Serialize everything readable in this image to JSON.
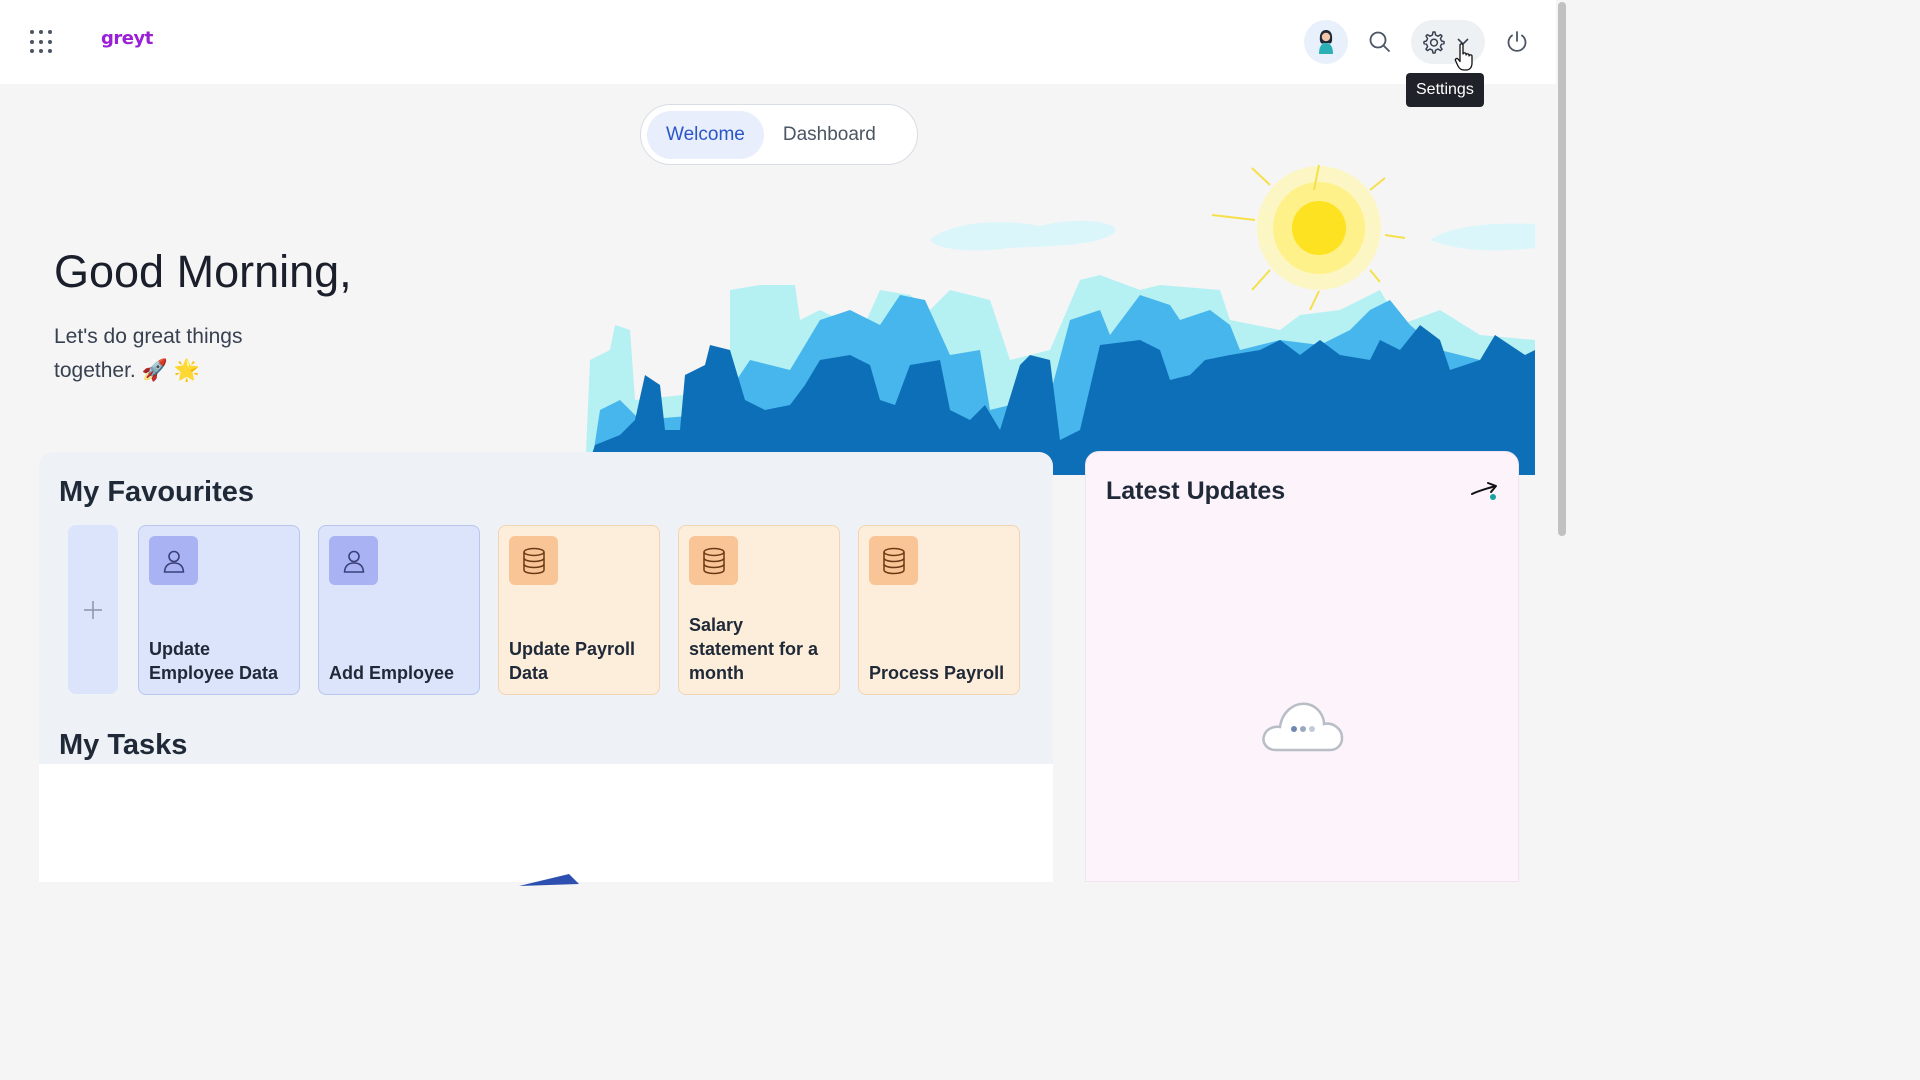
{
  "header": {
    "logo_text": "greyt",
    "settings_tooltip": "Settings"
  },
  "tabs": [
    {
      "label": "Welcome",
      "active": true
    },
    {
      "label": "Dashboard",
      "active": false
    }
  ],
  "greeting": {
    "title": "Good Morning,",
    "subtitle": "Let's do great things together. 🚀 🌟"
  },
  "favourites": {
    "title": "My Favourites",
    "items": [
      {
        "label": "Update Employee Data",
        "icon": "person-icon",
        "color": "blue"
      },
      {
        "label": "Add Employee",
        "icon": "person-icon",
        "color": "blue"
      },
      {
        "label": "Update Payroll Data",
        "icon": "database-icon",
        "color": "orange"
      },
      {
        "label": "Salary statement for a month",
        "icon": "database-icon",
        "color": "orange"
      },
      {
        "label": "Process Payroll",
        "icon": "database-icon",
        "color": "orange"
      }
    ]
  },
  "tasks": {
    "title": "My Tasks"
  },
  "updates": {
    "title": "Latest Updates"
  },
  "colors": {
    "accent": "#2b56c9",
    "logo": "#9b1fd6",
    "skyline_dark": "#0d6fb8",
    "skyline_mid": "#3fb2ec",
    "skyline_light": "#a6ecf2"
  }
}
